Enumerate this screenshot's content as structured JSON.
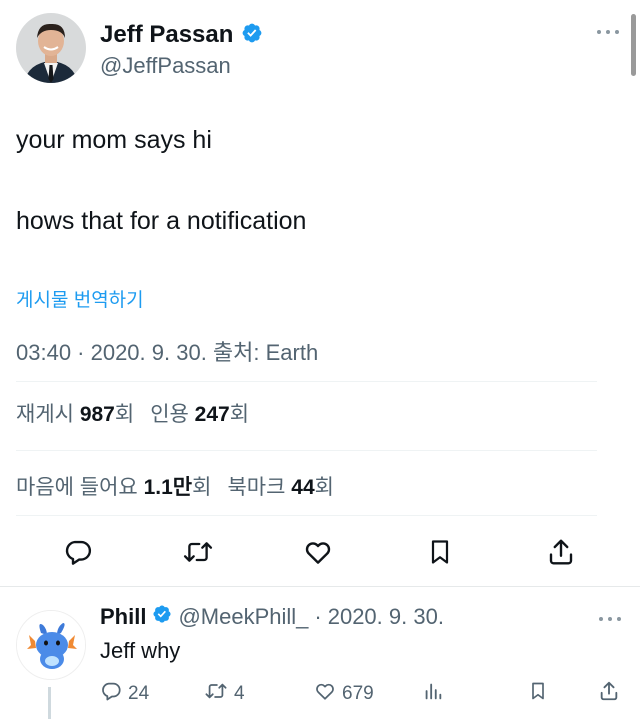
{
  "tweet": {
    "author_name": "Jeff Passan",
    "author_handle": "@JeffPassan",
    "line1": "your mom says hi",
    "line2": "hows that for a notification",
    "translate_label": "게시물 번역하기",
    "timestamp": "03:40 · 2020. 9. 30. 출처: Earth"
  },
  "stats": {
    "retweets_label": "재게시",
    "retweets_value": "987",
    "retweets_unit": "회",
    "quotes_label": "인용",
    "quotes_value": "247",
    "quotes_unit": "회",
    "likes_label": "마음에 들어요",
    "likes_value": "1.1만",
    "likes_unit": "회",
    "bookmarks_label": "북마크",
    "bookmarks_value": "44",
    "bookmarks_unit": "회"
  },
  "reply": {
    "author_name": "Phill",
    "author_handle": "@MeekPhill_",
    "separator": "·",
    "date": "2020. 9. 30.",
    "text": "Jeff why",
    "replies": "24",
    "retweets": "4",
    "likes": "679"
  },
  "colors": {
    "accent": "#1d9bf0",
    "muted": "#536471",
    "text": "#0f1419"
  },
  "icons": [
    "verified-badge-icon",
    "more-icon",
    "reply-icon",
    "retweet-icon",
    "like-icon",
    "bookmark-icon",
    "share-icon",
    "analytics-icon"
  ]
}
